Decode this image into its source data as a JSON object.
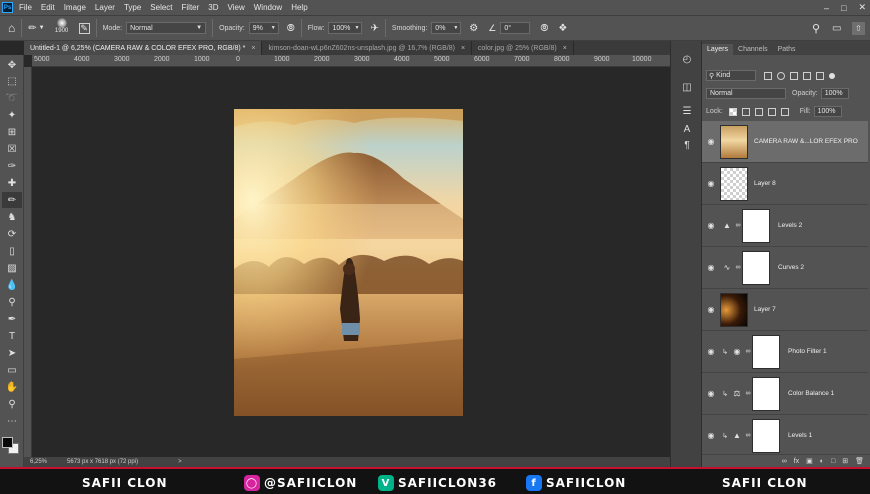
{
  "app": {
    "logo": "Ps",
    "menu": [
      "File",
      "Edit",
      "Image",
      "Layer",
      "Type",
      "Select",
      "Filter",
      "3D",
      "View",
      "Window",
      "Help"
    ]
  },
  "options": {
    "brush_size": "1900",
    "mode_label": "Mode:",
    "mode_value": "Normal",
    "opacity_label": "Opacity:",
    "opacity_value": "9%",
    "flow_label": "Flow:",
    "flow_value": "100%",
    "smoothing_label": "Smoothing:",
    "smoothing_value": "0%",
    "angle_value": "0°"
  },
  "tabs": [
    {
      "label": "Untitled-1 @ 6,25% (CAMERA RAW & COLOR EFEX PRO, RGB/8) *",
      "close": "×"
    },
    {
      "label": "kimson-doan-wLp6nZ602ns-unsplash.jpg @ 16,7% (RGB/8)",
      "close": "×"
    },
    {
      "label": "color.jpg @ 25% (RGB/8)",
      "close": "×"
    }
  ],
  "ruler_top": [
    "5000",
    "4000",
    "3000",
    "2000",
    "1000",
    "0",
    "1000",
    "2000",
    "3000",
    "4000",
    "5000",
    "6000",
    "7000",
    "8000",
    "9000",
    "10000"
  ],
  "status": {
    "zoom": "6,25%",
    "doc_size": "5673 px x 7618 px (72 ppi)",
    "arrow": ">"
  },
  "layers_panel": {
    "tabs": [
      "Layers",
      "Channels",
      "Paths"
    ],
    "kind_label": "Kind",
    "blend_mode": "Normal",
    "opacity_label": "Opacity:",
    "opacity_value": "100%",
    "lock_label": "Lock:",
    "fill_label": "Fill:",
    "fill_value": "100%",
    "layers": [
      {
        "name": "CAMERA RAW &...LOR EFEX PRO",
        "thumb": "photo",
        "selected": true
      },
      {
        "name": "Layer 8",
        "thumb": "transparent"
      },
      {
        "name": "Levels 2",
        "thumb": "mask",
        "icon": "levels-icon"
      },
      {
        "name": "Curves 2",
        "thumb": "mask",
        "icon": "curves-icon"
      },
      {
        "name": "Layer 7",
        "thumb": "dark"
      },
      {
        "name": "Photo Filter 1",
        "thumb": "mask",
        "icon": "photo-filter-icon",
        "clipped": true
      },
      {
        "name": "Color Balance 1",
        "thumb": "mask",
        "icon": "color-balance-icon",
        "clipped": true
      },
      {
        "name": "Levels 1",
        "thumb": "mask",
        "icon": "levels-icon",
        "clipped": true
      }
    ]
  },
  "banner": {
    "name_left": "SAFII CLON",
    "instagram": "@SAFIICLON",
    "vine": "SAFIICLON36",
    "facebook": "SAFIICLON",
    "name_right": "SAFII CLON"
  },
  "colors": {
    "accent_red": "#c8102e",
    "instagram": "#d6249f",
    "vine": "#00b489",
    "facebook": "#1877f2"
  }
}
